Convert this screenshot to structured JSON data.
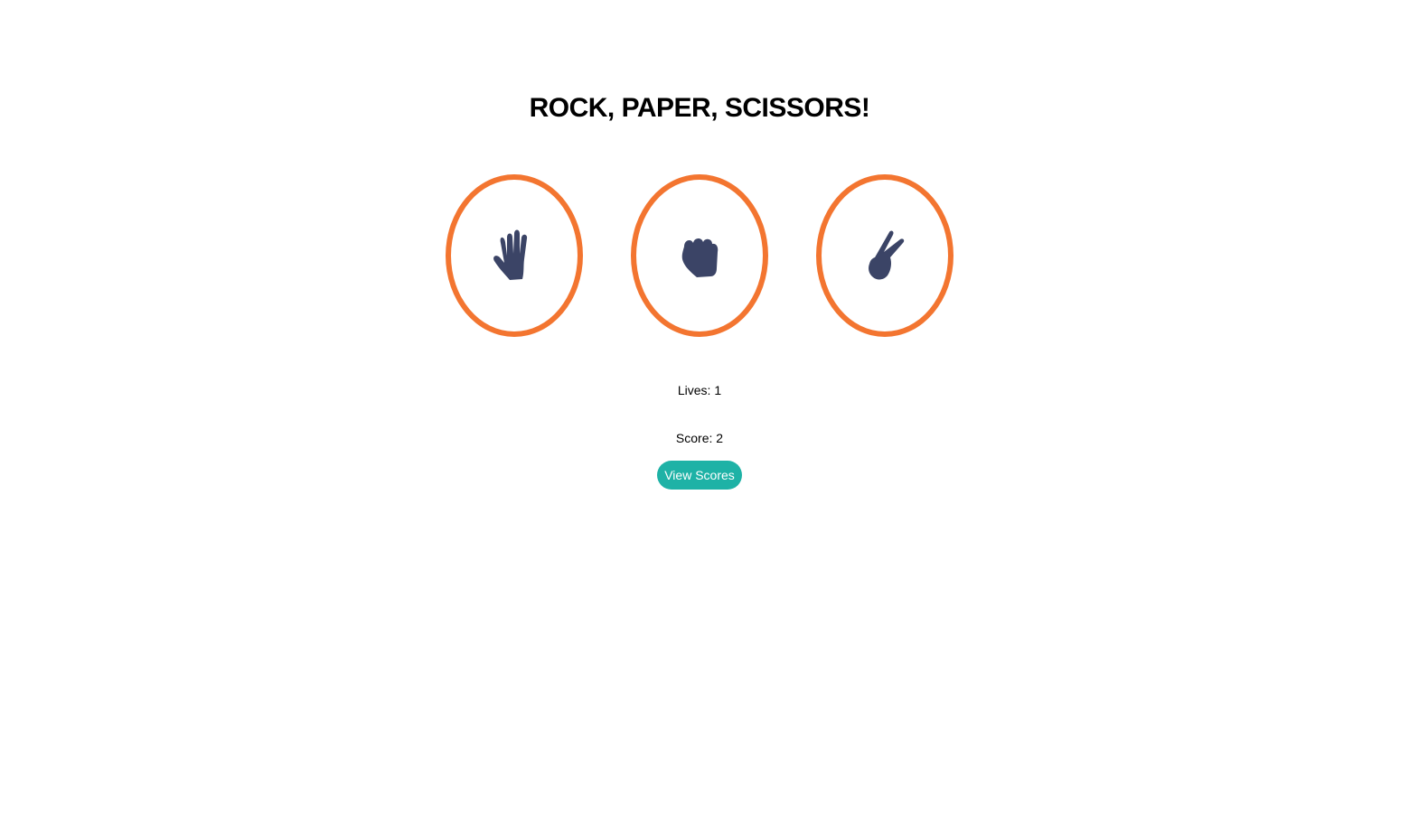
{
  "title": "ROCK, PAPER, SCISSORS!",
  "choices": [
    {
      "id": "paper",
      "icon": "open-hand-icon"
    },
    {
      "id": "rock",
      "icon": "fist-icon"
    },
    {
      "id": "scissors",
      "icon": "peace-hand-icon"
    }
  ],
  "colors": {
    "ring": "#f37530",
    "icon": "#3b4466",
    "button": "#1eb2a6"
  },
  "stats": {
    "lives": "Lives: 1",
    "score": "Score: 2"
  },
  "buttons": {
    "view_scores": "View Scores"
  }
}
